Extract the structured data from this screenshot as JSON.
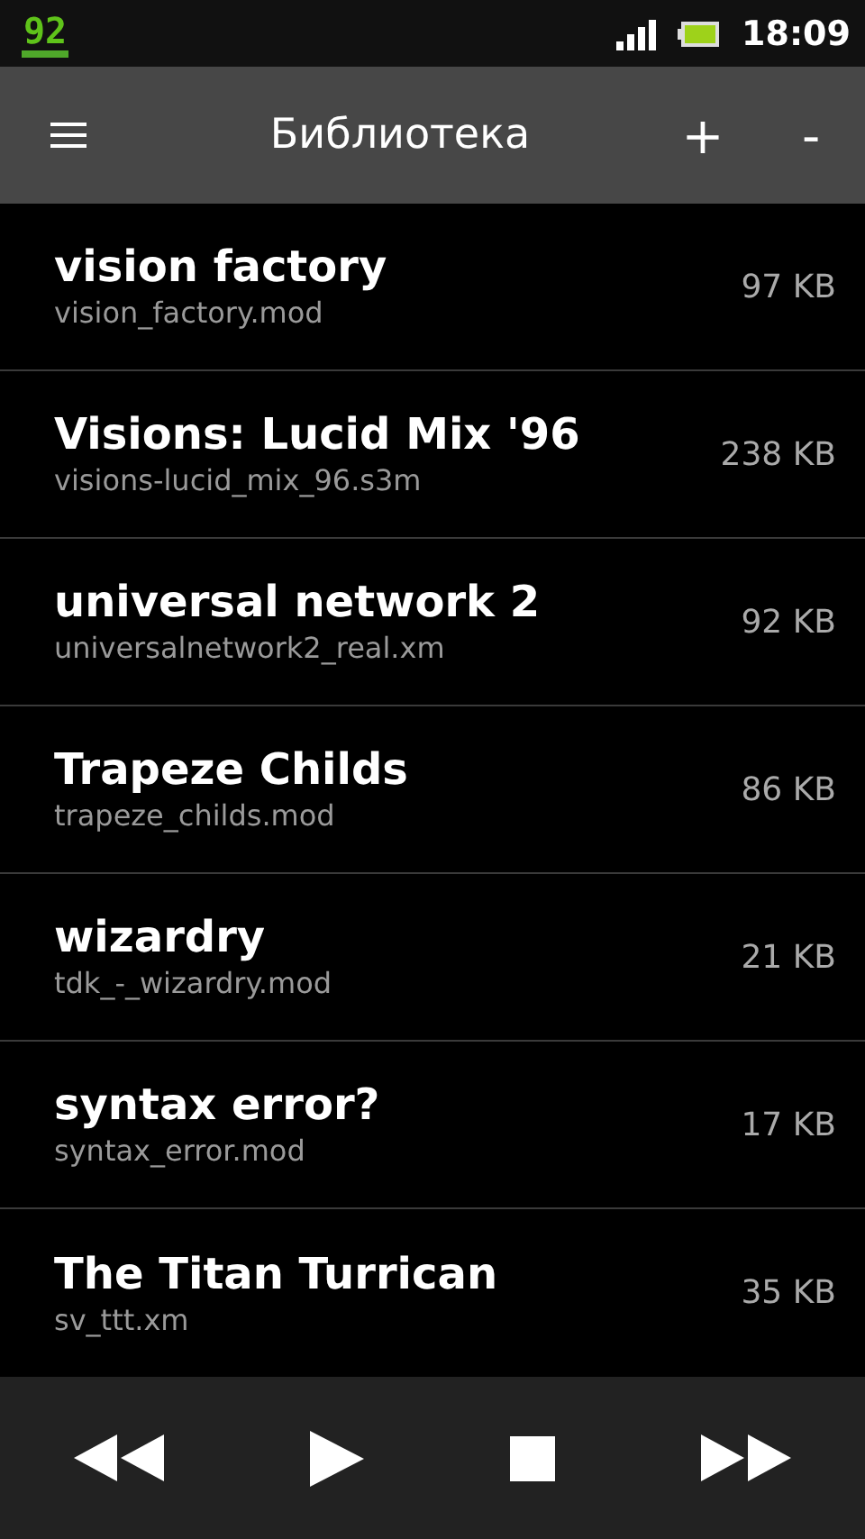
{
  "status_bar": {
    "notification": "92",
    "time": "18:09"
  },
  "action_bar": {
    "title": "Библиотека",
    "actions": [
      "+",
      "-"
    ]
  },
  "files": [
    {
      "title": "vision factory",
      "filename": "vision_factory.mod",
      "size": "97 KB"
    },
    {
      "title": "Visions: Lucid Mix '96",
      "filename": "visions-lucid_mix_96.s3m",
      "size": "238 KB"
    },
    {
      "title": "universal network 2",
      "filename": "universalnetwork2_real.xm",
      "size": "92 KB"
    },
    {
      "title": "Trapeze Childs",
      "filename": "trapeze_childs.mod",
      "size": "86 KB"
    },
    {
      "title": "wizardry",
      "filename": "tdk_-_wizardry.mod",
      "size": "21 KB"
    },
    {
      "title": "syntax error?",
      "filename": "syntax_error.mod",
      "size": "17 KB"
    },
    {
      "title": "The Titan Turrican",
      "filename": "sv_ttt.xm",
      "size": "35 KB"
    }
  ],
  "player_controls": [
    {
      "kind": "rewind"
    },
    {
      "kind": "play"
    },
    {
      "kind": "stop"
    },
    {
      "kind": "forward"
    }
  ]
}
